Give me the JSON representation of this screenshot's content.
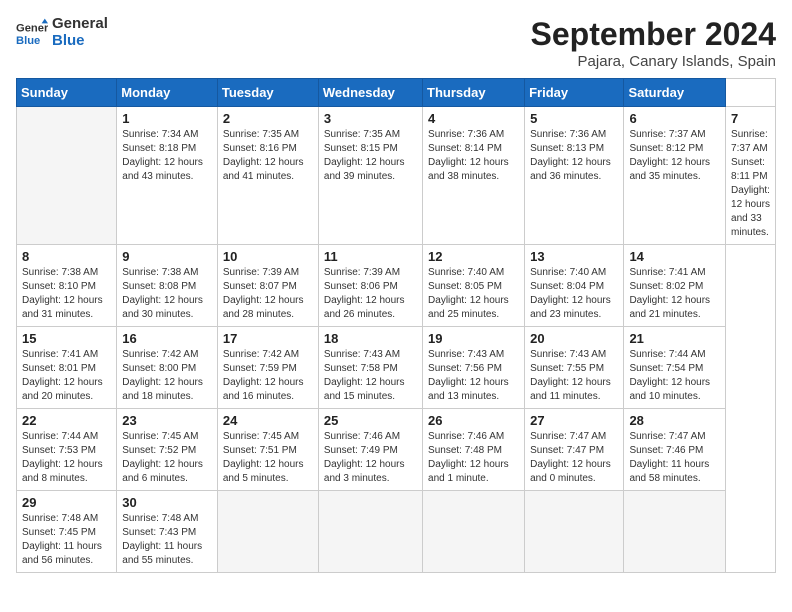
{
  "header": {
    "logo_general": "General",
    "logo_blue": "Blue",
    "title": "September 2024",
    "subtitle": "Pajara, Canary Islands, Spain"
  },
  "calendar": {
    "days_of_week": [
      "Sunday",
      "Monday",
      "Tuesday",
      "Wednesday",
      "Thursday",
      "Friday",
      "Saturday"
    ],
    "weeks": [
      [
        null,
        {
          "day": "1",
          "sunrise": "7:34 AM",
          "sunset": "8:18 PM",
          "daylight": "12 hours and 43 minutes."
        },
        {
          "day": "2",
          "sunrise": "7:35 AM",
          "sunset": "8:16 PM",
          "daylight": "12 hours and 41 minutes."
        },
        {
          "day": "3",
          "sunrise": "7:35 AM",
          "sunset": "8:15 PM",
          "daylight": "12 hours and 39 minutes."
        },
        {
          "day": "4",
          "sunrise": "7:36 AM",
          "sunset": "8:14 PM",
          "daylight": "12 hours and 38 minutes."
        },
        {
          "day": "5",
          "sunrise": "7:36 AM",
          "sunset": "8:13 PM",
          "daylight": "12 hours and 36 minutes."
        },
        {
          "day": "6",
          "sunrise": "7:37 AM",
          "sunset": "8:12 PM",
          "daylight": "12 hours and 35 minutes."
        },
        {
          "day": "7",
          "sunrise": "7:37 AM",
          "sunset": "8:11 PM",
          "daylight": "12 hours and 33 minutes."
        }
      ],
      [
        {
          "day": "8",
          "sunrise": "7:38 AM",
          "sunset": "8:10 PM",
          "daylight": "12 hours and 31 minutes."
        },
        {
          "day": "9",
          "sunrise": "7:38 AM",
          "sunset": "8:08 PM",
          "daylight": "12 hours and 30 minutes."
        },
        {
          "day": "10",
          "sunrise": "7:39 AM",
          "sunset": "8:07 PM",
          "daylight": "12 hours and 28 minutes."
        },
        {
          "day": "11",
          "sunrise": "7:39 AM",
          "sunset": "8:06 PM",
          "daylight": "12 hours and 26 minutes."
        },
        {
          "day": "12",
          "sunrise": "7:40 AM",
          "sunset": "8:05 PM",
          "daylight": "12 hours and 25 minutes."
        },
        {
          "day": "13",
          "sunrise": "7:40 AM",
          "sunset": "8:04 PM",
          "daylight": "12 hours and 23 minutes."
        },
        {
          "day": "14",
          "sunrise": "7:41 AM",
          "sunset": "8:02 PM",
          "daylight": "12 hours and 21 minutes."
        }
      ],
      [
        {
          "day": "15",
          "sunrise": "7:41 AM",
          "sunset": "8:01 PM",
          "daylight": "12 hours and 20 minutes."
        },
        {
          "day": "16",
          "sunrise": "7:42 AM",
          "sunset": "8:00 PM",
          "daylight": "12 hours and 18 minutes."
        },
        {
          "day": "17",
          "sunrise": "7:42 AM",
          "sunset": "7:59 PM",
          "daylight": "12 hours and 16 minutes."
        },
        {
          "day": "18",
          "sunrise": "7:43 AM",
          "sunset": "7:58 PM",
          "daylight": "12 hours and 15 minutes."
        },
        {
          "day": "19",
          "sunrise": "7:43 AM",
          "sunset": "7:56 PM",
          "daylight": "12 hours and 13 minutes."
        },
        {
          "day": "20",
          "sunrise": "7:43 AM",
          "sunset": "7:55 PM",
          "daylight": "12 hours and 11 minutes."
        },
        {
          "day": "21",
          "sunrise": "7:44 AM",
          "sunset": "7:54 PM",
          "daylight": "12 hours and 10 minutes."
        }
      ],
      [
        {
          "day": "22",
          "sunrise": "7:44 AM",
          "sunset": "7:53 PM",
          "daylight": "12 hours and 8 minutes."
        },
        {
          "day": "23",
          "sunrise": "7:45 AM",
          "sunset": "7:52 PM",
          "daylight": "12 hours and 6 minutes."
        },
        {
          "day": "24",
          "sunrise": "7:45 AM",
          "sunset": "7:51 PM",
          "daylight": "12 hours and 5 minutes."
        },
        {
          "day": "25",
          "sunrise": "7:46 AM",
          "sunset": "7:49 PM",
          "daylight": "12 hours and 3 minutes."
        },
        {
          "day": "26",
          "sunrise": "7:46 AM",
          "sunset": "7:48 PM",
          "daylight": "12 hours and 1 minute."
        },
        {
          "day": "27",
          "sunrise": "7:47 AM",
          "sunset": "7:47 PM",
          "daylight": "12 hours and 0 minutes."
        },
        {
          "day": "28",
          "sunrise": "7:47 AM",
          "sunset": "7:46 PM",
          "daylight": "11 hours and 58 minutes."
        }
      ],
      [
        {
          "day": "29",
          "sunrise": "7:48 AM",
          "sunset": "7:45 PM",
          "daylight": "11 hours and 56 minutes."
        },
        {
          "day": "30",
          "sunrise": "7:48 AM",
          "sunset": "7:43 PM",
          "daylight": "11 hours and 55 minutes."
        },
        null,
        null,
        null,
        null,
        null
      ]
    ],
    "labels": {
      "sunrise": "Sunrise:",
      "sunset": "Sunset:",
      "daylight": "Daylight hours"
    }
  }
}
